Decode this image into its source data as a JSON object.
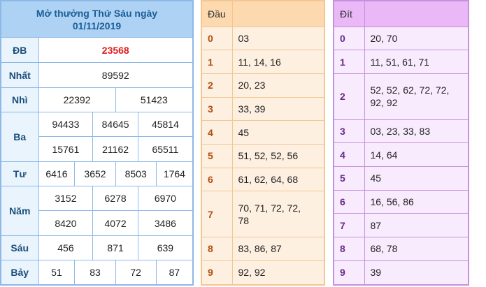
{
  "results": {
    "title_line1": "Mở thưởng Thứ Sáu ngày",
    "title_line2": "01/11/2019",
    "db": {
      "label": "ĐB",
      "values": [
        "23568"
      ]
    },
    "nhat": {
      "label": "Nhất",
      "values": [
        "89592"
      ]
    },
    "nhi": {
      "label": "Nhì",
      "values": [
        "22392",
        "51423"
      ]
    },
    "ba": {
      "label": "Ba",
      "values": [
        "94433",
        "84645",
        "45814",
        "15761",
        "21162",
        "65511"
      ]
    },
    "tu": {
      "label": "Tư",
      "values": [
        "6416",
        "3652",
        "8503",
        "1764"
      ]
    },
    "nam": {
      "label": "Năm",
      "values": [
        "3152",
        "6278",
        "6970",
        "8420",
        "4072",
        "3486"
      ]
    },
    "sau": {
      "label": "Sáu",
      "values": [
        "456",
        "871",
        "639"
      ]
    },
    "bay": {
      "label": "Bảy",
      "values": [
        "51",
        "83",
        "72",
        "87"
      ]
    }
  },
  "dau": {
    "header": "Đầu",
    "rows": [
      {
        "key": "0",
        "values": "03"
      },
      {
        "key": "1",
        "values": "11, 14, 16"
      },
      {
        "key": "2",
        "values": "20, 23"
      },
      {
        "key": "3",
        "values": "33, 39"
      },
      {
        "key": "4",
        "values": "45"
      },
      {
        "key": "5",
        "values": "51, 52, 52, 56"
      },
      {
        "key": "6",
        "values": "61, 62, 64, 68"
      },
      {
        "key": "7",
        "values": "70, 71, 72, 72, 78"
      },
      {
        "key": "8",
        "values": "83, 86, 87"
      },
      {
        "key": "9",
        "values": "92, 92"
      }
    ]
  },
  "dit": {
    "header": "Đít",
    "rows": [
      {
        "key": "0",
        "values": "20, 70"
      },
      {
        "key": "1",
        "values": "11, 51, 61, 71"
      },
      {
        "key": "2",
        "values": "52, 52, 62, 72, 72, 92, 92"
      },
      {
        "key": "3",
        "values": "03, 23, 33, 83"
      },
      {
        "key": "4",
        "values": "14, 64"
      },
      {
        "key": "5",
        "values": "45"
      },
      {
        "key": "6",
        "values": "16, 56, 86"
      },
      {
        "key": "7",
        "values": "87"
      },
      {
        "key": "8",
        "values": "68, 78"
      },
      {
        "key": "9",
        "values": "39"
      }
    ]
  },
  "colors": {
    "results_border": "#8db8e8",
    "special_prize": "#e11b1b",
    "dau_header": "#fdd9b0",
    "dit_header": "#eab8f6"
  }
}
